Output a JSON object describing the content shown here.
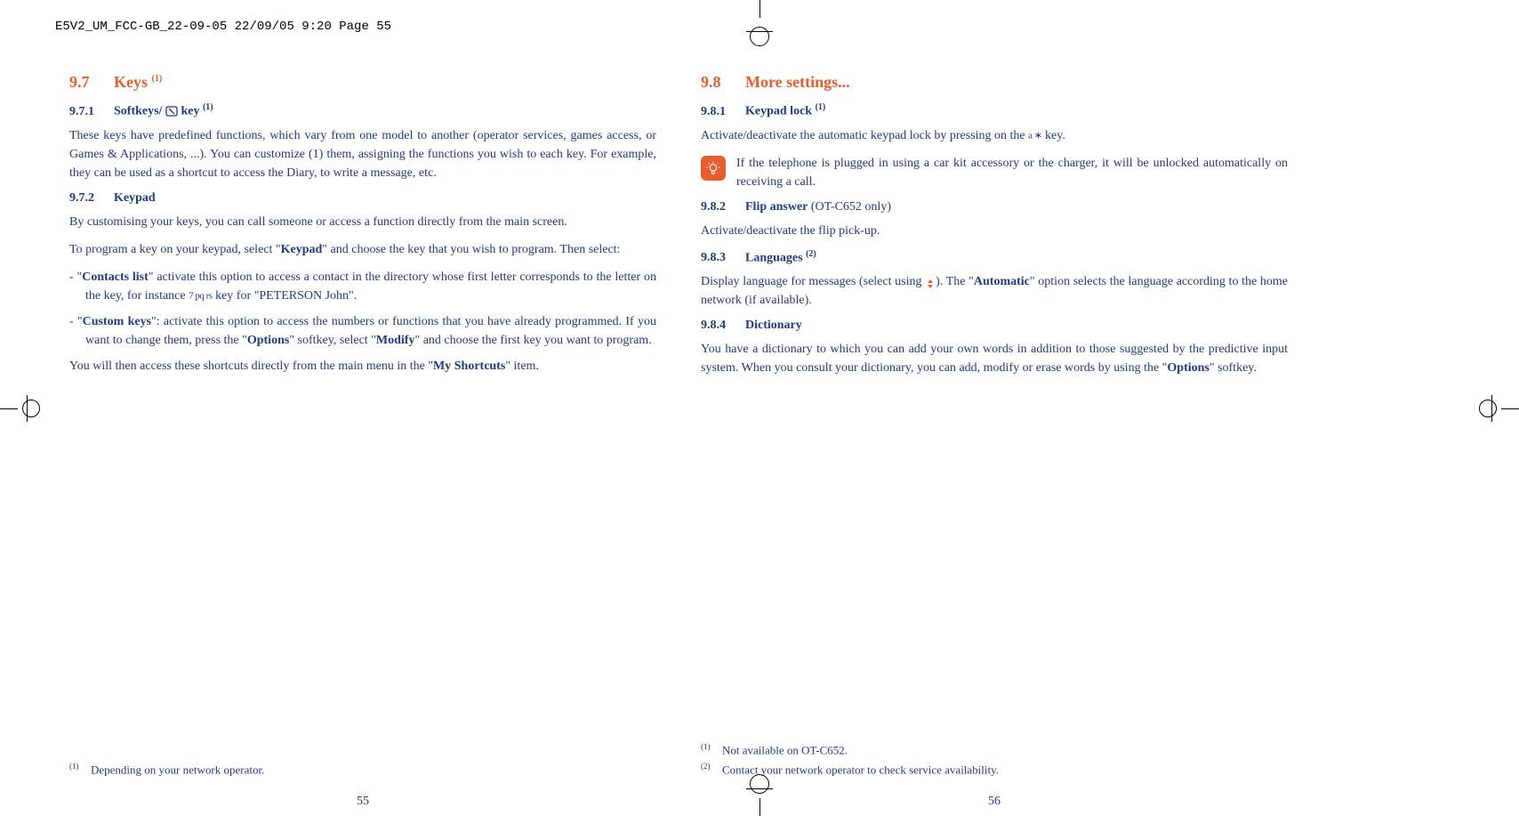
{
  "header": "E5V2_UM_FCC-GB_22-09-05  22/09/05  9:20  Page 55",
  "left": {
    "s97": {
      "num": "9.7",
      "title": "Keys",
      "sup": "(1)"
    },
    "s971": {
      "num": "9.7.1",
      "title": "Softkeys/",
      "key_suffix": "key",
      "sup": "(1)"
    },
    "p971": "These keys have predefined functions, which vary from one model to another (operator services, games access, or Games & Applications, ...). You can customize (1) them, assigning the functions you wish to each key. For example, they can be used as a shortcut to access the Diary, to write a message, etc.",
    "s972": {
      "num": "9.7.2",
      "title": "Keypad"
    },
    "p972a": "By customising your keys, you can call someone or access a function directly from the main screen.",
    "p972b_pre": "To program a key on your keypad, select \"",
    "p972b_bold": "Keypad",
    "p972b_post": "\" and choose the key that you wish to program. Then select:",
    "li1_pre": "-  \"",
    "li1_bold": "Contacts list",
    "li1_post": "\" activate this option to access a contact in the directory whose first letter corresponds to the letter on the key, for instance ",
    "li1_key": "7 pq rs",
    "li1_end": " key for \"PETERSON John\".",
    "li2_pre": "-  \"",
    "li2_bold": "Custom keys",
    "li2_mid": "\": activate this option to access the numbers or functions that you have already programmed. If you want to change them, press the \"",
    "li2_bold2": "Options",
    "li2_mid2": "\" softkey, select \"",
    "li2_bold3": "Modify",
    "li2_end": "\" and choose the first key you want to program.",
    "p972c_pre": "You will then access these shortcuts directly from the main menu in the \"",
    "p972c_bold": "My Shortcuts",
    "p972c_end": "\" item.",
    "fn1": {
      "sup": "(1)",
      "text": "Depending on your network operator."
    },
    "pagenum": "55"
  },
  "right": {
    "s98": {
      "num": "9.8",
      "title": "More settings..."
    },
    "s981": {
      "num": "9.8.1",
      "title": "Keypad lock",
      "sup": "(1)"
    },
    "p981_pre": "Activate/deactivate the automatic keypad lock by pressing on the ",
    "p981_key": "a ∗",
    "p981_end": " key.",
    "info": "If the telephone is plugged in using a car kit accessory or the charger, it will be unlocked automatically on receiving a call.",
    "s982": {
      "num": "9.8.2",
      "title": "Flip answer",
      "note": " (OT-C652 only)"
    },
    "p982": "Activate/deactivate the flip pick-up.",
    "s983": {
      "num": "9.8.3",
      "title": "Languages",
      "sup": "(2)"
    },
    "p983_pre": "Display language for messages (select using ",
    "p983_mid": "). The \"",
    "p983_bold": "Automatic",
    "p983_end": "\" option selects the language according to the home network (if available).",
    "s984": {
      "num": "9.8.4",
      "title": "Dictionary"
    },
    "p984_pre": "You have a dictionary to which you can add your own words in addition to those suggested by the predictive input system. When you consult your dictionary, you can add, modify or erase words by using the \"",
    "p984_bold": "Options",
    "p984_end": "\" softkey.",
    "fn1": {
      "sup": "(1)",
      "text": "Not available on OT-C652."
    },
    "fn2": {
      "sup": "(2)",
      "text": "Contact your network operator to check service availability."
    },
    "pagenum": "56"
  }
}
